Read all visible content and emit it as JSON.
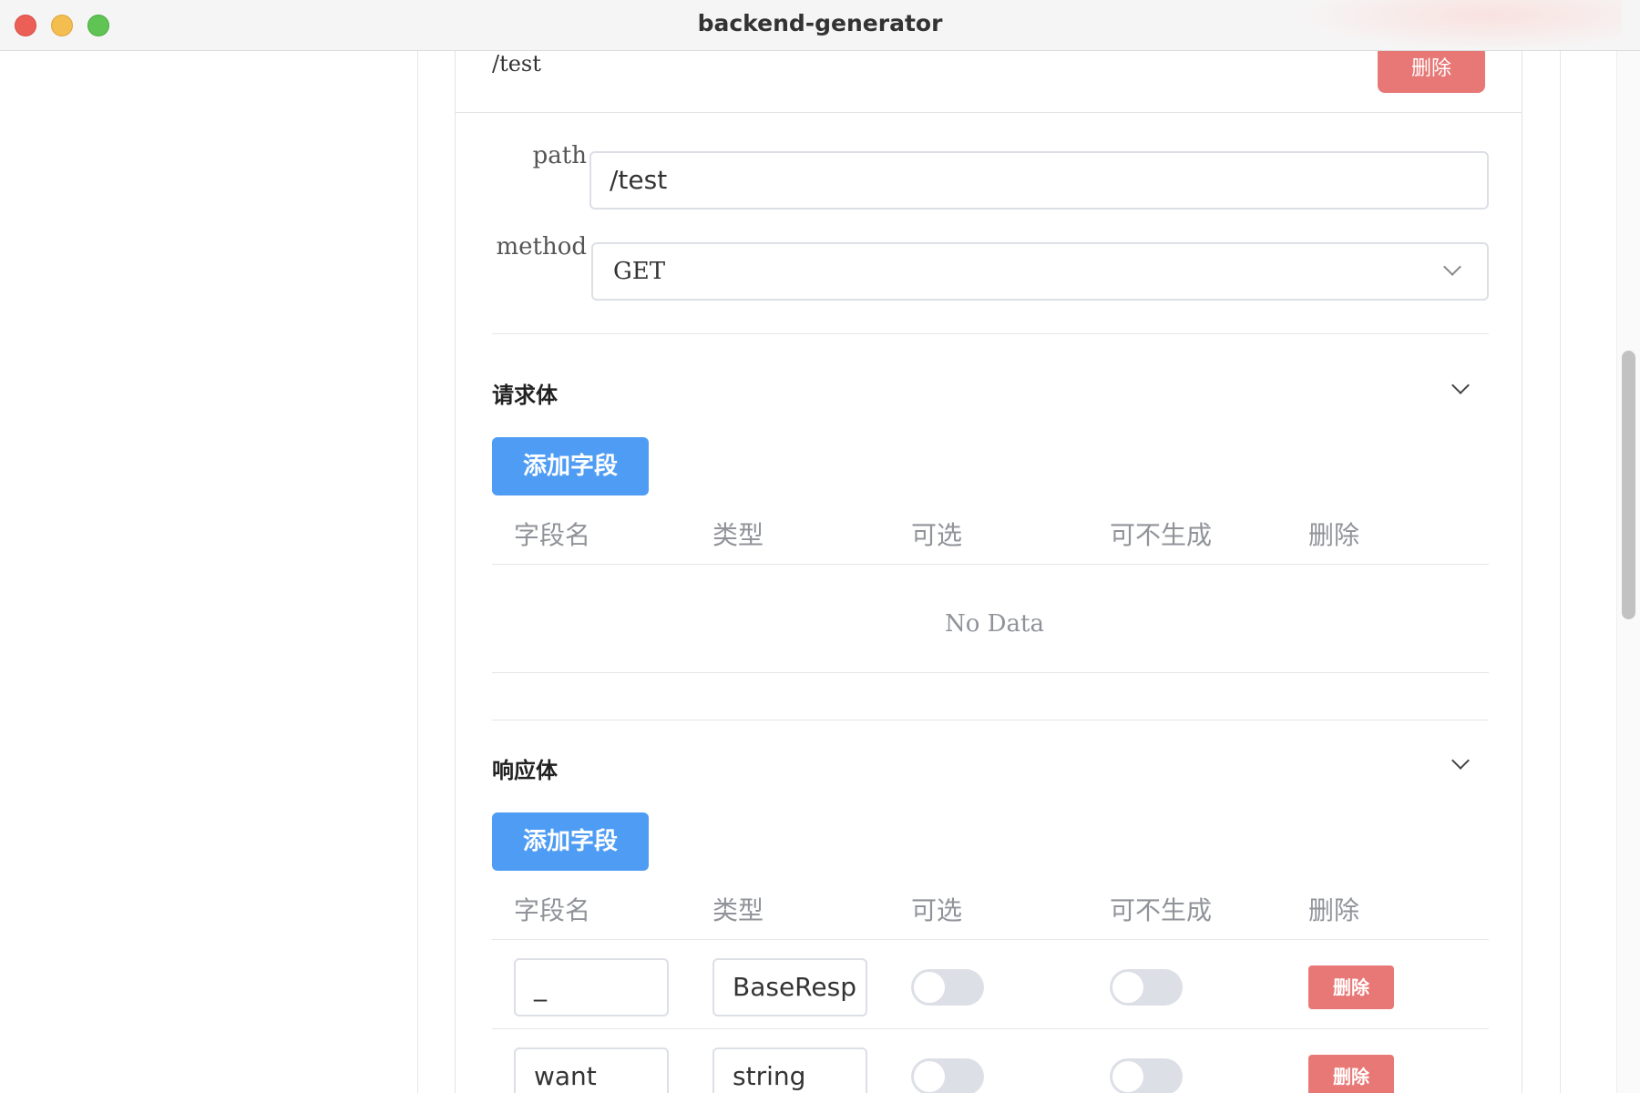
{
  "window": {
    "title": "backend-generator"
  },
  "route": {
    "header_title": "/test",
    "delete_label": "删除",
    "path_label": "path",
    "path_value": "/test",
    "method_label": "method",
    "method_value": "GET"
  },
  "request_body": {
    "title": "请求体",
    "add_field_label": "添加字段",
    "columns": [
      "字段名",
      "类型",
      "可选",
      "可不生成",
      "删除"
    ],
    "empty_text": "No Data"
  },
  "response_body": {
    "title": "响应体",
    "add_field_label": "添加字段",
    "columns": [
      "字段名",
      "类型",
      "可选",
      "可不生成",
      "删除"
    ],
    "rows": [
      {
        "name": "_",
        "type": "BaseResp",
        "optional": false,
        "skip_generate": false,
        "delete_label": "删除"
      },
      {
        "name": "want",
        "type": "string",
        "optional": false,
        "skip_generate": false,
        "delete_label": "删除"
      }
    ]
  },
  "colors": {
    "primary": "#4e9cf3",
    "danger": "#e77876",
    "switch_off": "#dcdfe6"
  },
  "icons": [
    "chevron-down-icon",
    "close-dot-icon",
    "minimize-dot-icon",
    "zoom-dot-icon"
  ]
}
